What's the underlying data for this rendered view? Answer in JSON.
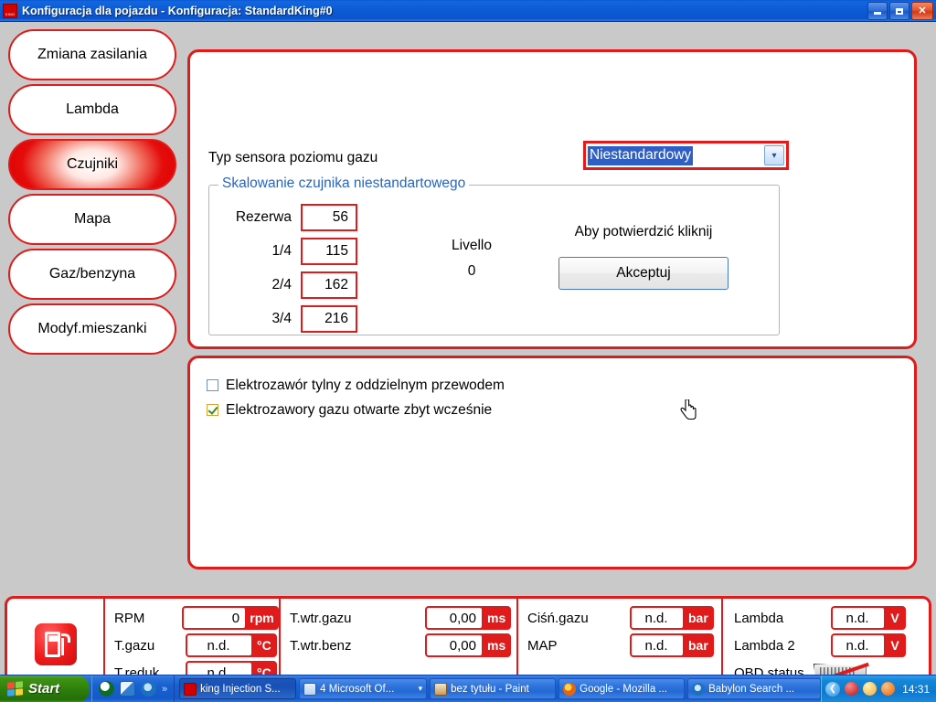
{
  "window": {
    "title": "Konfiguracja dla pojazdu - Konfiguracja: StandardKing#0",
    "icon": "king-app-icon",
    "minimize_label": "",
    "restore_label": "",
    "close_label": "✕"
  },
  "sidebar": {
    "items": [
      {
        "label": "Zmiana zasilania",
        "active": false
      },
      {
        "label": "Lambda",
        "active": false
      },
      {
        "label": "Czujniki",
        "active": true
      },
      {
        "label": "Mapa",
        "active": false
      },
      {
        "label": "Gaz/benzyna",
        "active": false
      },
      {
        "label": "Modyf.mieszanki",
        "active": false
      }
    ]
  },
  "main": {
    "sensor_type_label": "Typ sensora poziomu gazu",
    "sensor_type_value": "Niestandardowy",
    "dropdown_arrow": "▾",
    "groupbox_legend": "Skalowanie czujnika niestandartowego",
    "scale_rows": [
      {
        "label": "Rezerwa",
        "value": "56"
      },
      {
        "label": "1/4",
        "value": "115"
      },
      {
        "label": "2/4",
        "value": "162"
      },
      {
        "label": "3/4",
        "value": "216"
      }
    ],
    "livello_label": "Livello",
    "livello_value": "0",
    "confirm_text": "Aby potwierdzić kliknij",
    "accept_label": "Akceptuj"
  },
  "options": {
    "checkboxes": [
      {
        "label": "Elektrozawór tylny z oddzielnym przewodem",
        "checked": false
      },
      {
        "label": "Elektrozawory gazu otwarte zbyt wcześnie",
        "checked": true
      }
    ]
  },
  "statusbar": {
    "icon": "fuel-pump-icon",
    "group1": [
      {
        "label": "RPM",
        "value": "0",
        "unit": "rpm"
      },
      {
        "label": "T.gazu",
        "value": "n.d.",
        "unit": "°C"
      },
      {
        "label": "T.reduk.",
        "value": "n.d.",
        "unit": "°C"
      }
    ],
    "group2": [
      {
        "label": "T.wtr.gazu",
        "value": "0,00",
        "unit": "ms"
      },
      {
        "label": "T.wtr.benz",
        "value": "0,00",
        "unit": "ms"
      }
    ],
    "group3": [
      {
        "label": "Ciśń.gazu",
        "value": "n.d.",
        "unit": "bar"
      },
      {
        "label": "MAP",
        "value": "n.d.",
        "unit": "bar"
      }
    ],
    "group4": [
      {
        "label": "Lambda",
        "value": "n.d.",
        "unit": "V"
      },
      {
        "label": "Lambda 2",
        "value": "n.d.",
        "unit": "V"
      }
    ],
    "obd_label": "OBD status",
    "obd_icon": "obd-connector-disabled-icon"
  },
  "taskbar": {
    "start_label": "Start",
    "quicklaunch": [
      {
        "name": "opera-icon",
        "color": "#0d6b2e"
      },
      {
        "name": "notes-icon",
        "color": "#2f7ecd"
      },
      {
        "name": "internet-explorer-icon",
        "color": "#1d6fc0"
      }
    ],
    "quicklaunch_more": "»",
    "tasks": [
      {
        "label": "king Injection S...",
        "icon": "king-app-icon",
        "active": true,
        "dropdown": ""
      },
      {
        "label": "4 Microsoft Of...",
        "icon": "word-icon",
        "active": false,
        "dropdown": "▾"
      },
      {
        "label": "bez tytułu - Paint",
        "icon": "paint-icon",
        "active": false,
        "dropdown": ""
      },
      {
        "label": "Google - Mozilla ...",
        "icon": "firefox-icon",
        "active": false,
        "dropdown": ""
      },
      {
        "label": "Babylon Search ...",
        "icon": "internet-explorer-icon",
        "active": false,
        "dropdown": ""
      }
    ],
    "tray": {
      "expand": "❮",
      "icons": [
        {
          "name": "tray-red-icon",
          "color": "#d02222"
        },
        {
          "name": "tray-weather-icon",
          "color": "#f2c93c"
        },
        {
          "name": "tray-orange-icon",
          "color": "#f07a12"
        }
      ],
      "clock": "14:31"
    }
  },
  "colors": {
    "accent_red": "#e01b1b",
    "group_label_blue": "#2864c8",
    "selection_blue": "#2f5fc4",
    "title_blue": "#0e5cd8"
  }
}
